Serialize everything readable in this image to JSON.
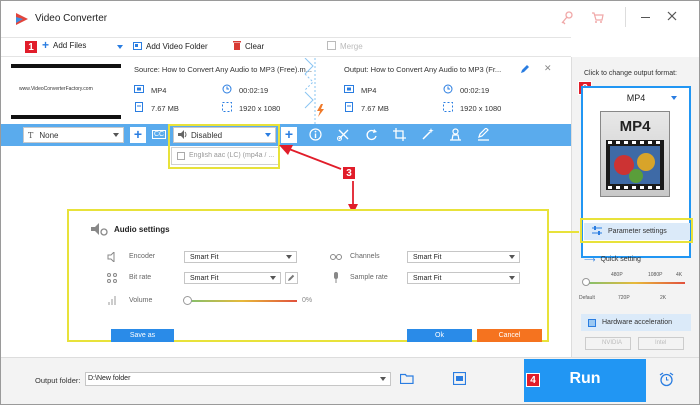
{
  "app": {
    "title": "Video Converter"
  },
  "toolbar": {
    "badge1": "1",
    "add_files": "Add Files",
    "add_video_folder": "Add Video Folder",
    "clear": "Clear",
    "merge": "Merge"
  },
  "file": {
    "thumb_text": "www.VideoConverterFactory.com",
    "source_label": "Source: How to Convert Any Audio to MP3 (Free).m...",
    "src_format": "MP4",
    "src_duration": "00:02:19",
    "src_size": "7.67 MB",
    "src_resolution": "1920 x 1080",
    "output_label": "Output: How to Convert Any Audio to MP3 (Fr...",
    "out_format": "MP4",
    "out_duration": "00:02:19",
    "out_size": "7.67 MB",
    "out_resolution": "1920 x 1080"
  },
  "editbar": {
    "subtitle_value": "None",
    "audio_value": "Disabled",
    "audio_option": "English aac (LC) (mp4a / ..."
  },
  "right": {
    "change_format_label": "Click to change output format:",
    "badge2": "2",
    "format_name": "MP4",
    "format_tile": "MP4",
    "parameter_settings": "Parameter settings",
    "quick_setting": "Quick setting",
    "ticks_top": [
      "480P",
      "1080P",
      "4K"
    ],
    "ticks_bottom": [
      "Default",
      "720P",
      "2K"
    ],
    "hw_accel": "Hardware acceleration",
    "nvidia": "NVIDIA",
    "intel": "Intel"
  },
  "callout": {
    "badge3": "3"
  },
  "audio": {
    "title": "Audio settings",
    "encoder_label": "Encoder",
    "encoder_value": "Smart Fit",
    "bitrate_label": "Bit rate",
    "bitrate_value": "Smart Fit",
    "volume_label": "Volume",
    "volume_value": "0%",
    "channels_label": "Channels",
    "channels_value": "Smart Fit",
    "samplerate_label": "Sample rate",
    "samplerate_value": "Smart Fit",
    "save_as": "Save as",
    "ok": "Ok",
    "cancel": "Cancel"
  },
  "bottom": {
    "output_folder_label": "Output folder:",
    "output_folder_value": "D:\\New folder",
    "badge4": "4",
    "run": "Run"
  },
  "colors": {
    "accent_blue": "#2196f3",
    "badge_red": "#e11d2a",
    "highlight_yellow": "#e8e23a",
    "cancel_orange": "#f5731f"
  }
}
